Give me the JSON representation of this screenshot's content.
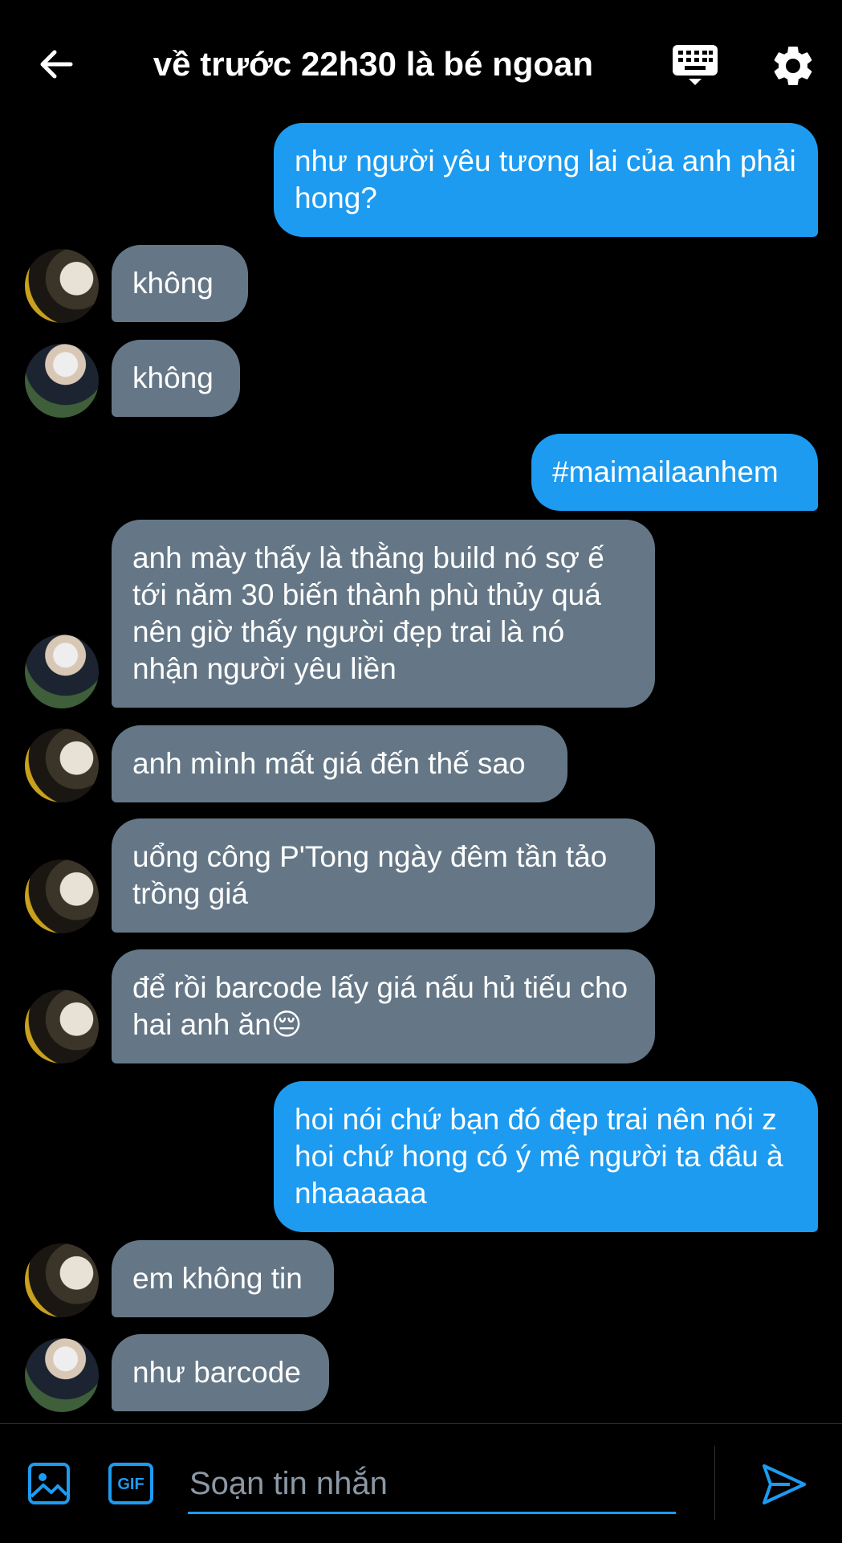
{
  "header": {
    "title": "về trước 22h30 là bé ngoan",
    "icons": [
      "back-arrow-icon",
      "keyboard-icon",
      "gear-icon"
    ]
  },
  "messages": [
    {
      "side": "out",
      "text": "như người yêu tương lai của anh phải hong?"
    },
    {
      "side": "in",
      "avatar": "a",
      "text": "không"
    },
    {
      "side": "in",
      "avatar": "b",
      "text": "không"
    },
    {
      "side": "out",
      "text": "#maimailaanhem"
    },
    {
      "side": "in",
      "avatar": "b",
      "text": "anh mày thấy là thằng build nó sợ ế tới năm 30 biến thành phù thủy quá nên giờ thấy người đẹp trai là nó nhận người yêu liền"
    },
    {
      "side": "in",
      "avatar": "a",
      "text": "anh mình mất giá đến thế sao"
    },
    {
      "side": "in",
      "avatar": "a",
      "text": "uổng công P'Tong ngày đêm tần tảo trồng giá"
    },
    {
      "side": "in",
      "avatar": "a",
      "text": "để rồi barcode lấy giá nấu hủ tiếu cho hai anh ăn😔"
    },
    {
      "side": "out",
      "text": "hoi nói chứ bạn đó đẹp trai nên nói z hoi chứ hong có ý mê người ta đâu à nhaaaaaa"
    },
    {
      "side": "in",
      "avatar": "a",
      "text": "em không tin"
    },
    {
      "side": "in",
      "avatar": "b",
      "text": "như barcode"
    }
  ],
  "composer": {
    "placeholder": "Soạn tin nhắn",
    "gif_label": "GIF",
    "icons": [
      "image-icon",
      "gif-icon",
      "send-icon"
    ]
  },
  "colors": {
    "background": "#000000",
    "outgoing_bubble": "#1d9bf0",
    "incoming_bubble": "#657786",
    "accent": "#1d9bf0",
    "placeholder": "#8b98a5"
  }
}
